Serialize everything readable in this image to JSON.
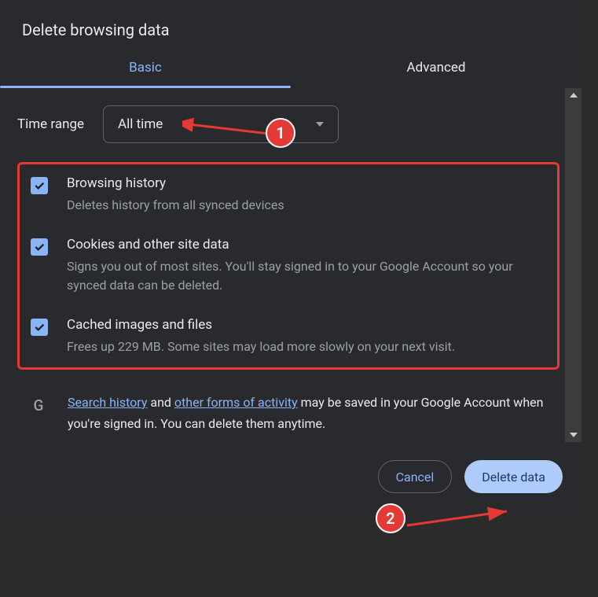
{
  "dialog": {
    "title": "Delete browsing data",
    "tabs": {
      "basic": "Basic",
      "advanced": "Advanced"
    },
    "timeRange": {
      "label": "Time range",
      "value": "All time"
    },
    "options": [
      {
        "title": "Browsing history",
        "desc": "Deletes history from all synced devices"
      },
      {
        "title": "Cookies and other site data",
        "desc": "Signs you out of most sites. You'll stay signed in to your Google Account so your synced data can be deleted."
      },
      {
        "title": "Cached images and files",
        "desc": "Frees up 229 MB. Some sites may load more slowly on your next visit."
      }
    ],
    "info": {
      "icon": "G",
      "link1": "Search history",
      "mid1": " and ",
      "link2": "other forms of activity",
      "mid2": " may be saved in your Google Account when you're signed in. You can delete them anytime."
    },
    "buttons": {
      "cancel": "Cancel",
      "delete": "Delete data"
    }
  },
  "annotations": {
    "badge1": "1",
    "badge2": "2"
  }
}
